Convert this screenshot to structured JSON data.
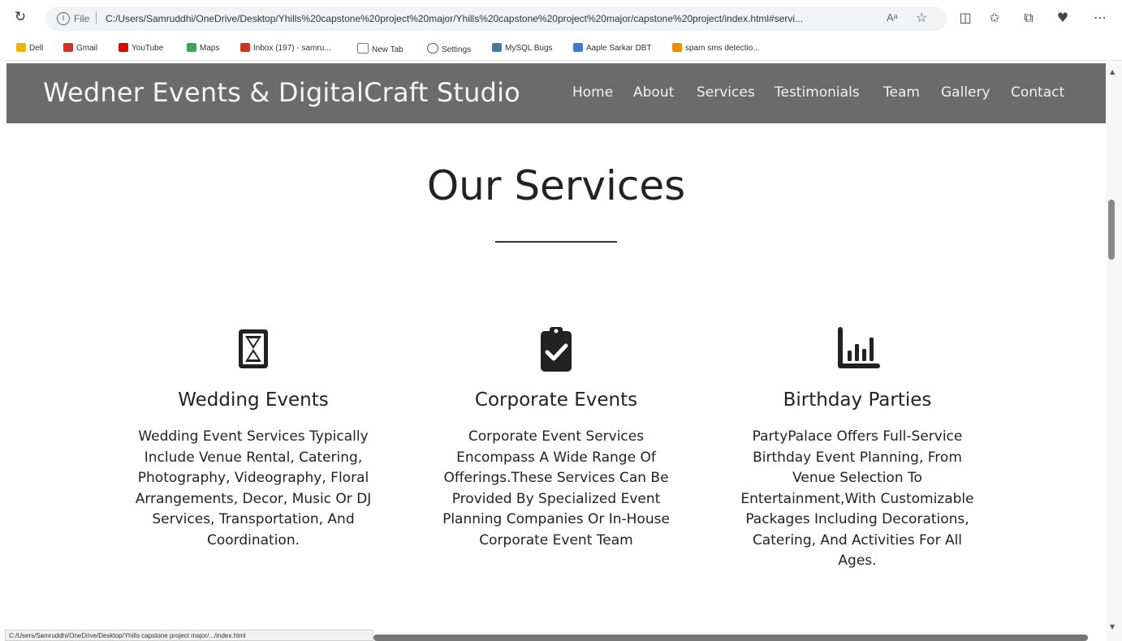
{
  "browser": {
    "address_scheme": "File",
    "url": "C:/Users/Samruddhi/OneDrive/Desktop/Yhills%20capstone%20project%20major/Yhills%20capstone%20project%20major/capstone%20project/index.html#servi...",
    "read_aloud": "Aᵃ",
    "bookmarks": [
      {
        "label": "Dell",
        "icon": "folder-icon",
        "color": "#f0b400"
      },
      {
        "label": "Gmail",
        "icon": "gmail-icon",
        "color": "#d93025"
      },
      {
        "label": "YouTube",
        "icon": "youtube-icon",
        "color": "#e00000"
      },
      {
        "label": "Maps",
        "icon": "maps-icon",
        "color": "#34a853"
      },
      {
        "label": "Inbox (197) - samru...",
        "icon": "gmail-icon",
        "color": "#d93025"
      },
      {
        "label": "New Tab",
        "icon": "page-icon",
        "color": "#777777"
      },
      {
        "label": "Settings",
        "icon": "gear-icon",
        "color": "#555555"
      },
      {
        "label": "MySQL Bugs",
        "icon": "mysql-icon",
        "color": "#4479a1"
      },
      {
        "label": "Aaple Sarkar DBT",
        "icon": "bookmark-icon",
        "color": "#3a7bd5"
      },
      {
        "label": "spam sms detectio...",
        "icon": "app-icon",
        "color": "#f08c00"
      }
    ],
    "status_url": "C:/Users/Samruddhi/OneDrive/Desktop/Yhills capstone project major/.../index.html"
  },
  "header": {
    "brand": "Wedner Events & DigitalCraft Studio",
    "nav": [
      "Home",
      "About",
      "Services",
      "Testimonials",
      "Team",
      "Gallery",
      "Contact"
    ]
  },
  "services": {
    "title": "Our Services",
    "cards": [
      {
        "icon": "hourglass-icon",
        "title": "Wedding Events",
        "text": "Wedding Event Services Typically Include Venue Rental, Catering, Photography, Videography, Floral Arrangements, Decor, Music Or DJ Services, Transportation, And Coordination."
      },
      {
        "icon": "clipboard-check-icon",
        "title": "Corporate Events",
        "text": "Corporate Event Services Encompass A Wide Range Of Offerings.These Services Can Be Provided By Specialized Event Planning Companies Or In-House Corporate Event Team"
      },
      {
        "icon": "bar-chart-icon",
        "title": "Birthday Parties",
        "text": "PartyPalace Offers Full-Service Birthday Event Planning, From Venue Selection To Entertainment,With Customizable Packages Including Decorations, Catering, And Activities For All Ages."
      }
    ]
  },
  "colors": {
    "header_bg": "#6b6b6b",
    "header_text": "#f4f4f4",
    "body_text": "#222222"
  }
}
